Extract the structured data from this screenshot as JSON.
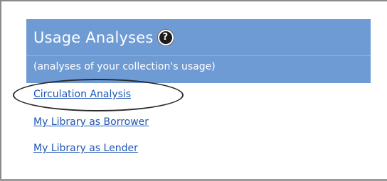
{
  "panel": {
    "title": "Usage Analyses",
    "help_icon": "help-icon",
    "help_symbol": "?",
    "subtitle": "(analyses of your collection's usage)"
  },
  "links": [
    {
      "label": "Circulation Analysis"
    },
    {
      "label": "My Library as Borrower"
    },
    {
      "label": "My Library as Lender"
    }
  ],
  "colors": {
    "panel_background": "#6f9bd4",
    "link": "#1f56b4",
    "panel_text": "#ffffff"
  }
}
